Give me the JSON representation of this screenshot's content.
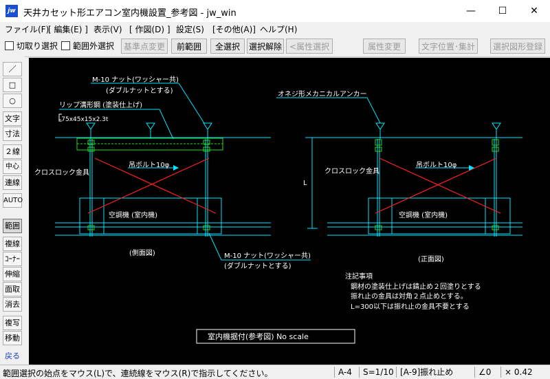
{
  "window": {
    "title": "天井カセット形エアコン室内機設置_参考図 - jw_win",
    "icon_label": "jw",
    "minimize": "—",
    "maximize": "☐",
    "close": "✕"
  },
  "menu": [
    "ファイル(F)",
    "[ 編集(E) ]",
    "表示(V)",
    "[ 作図(D) ]",
    "設定(S)",
    "[その他(A)]",
    "ヘルプ(H)"
  ],
  "toolbar": {
    "check_cut": "切取り選択",
    "check_outside": "範囲外選択",
    "btn_base_change": "基準点変更",
    "btn_prev_range": "前範囲",
    "btn_select_all": "全選択",
    "btn_deselect": "選択解除",
    "btn_attr_select": "<属性選択>",
    "btn_attr_change": "属性変更",
    "btn_text_pos": "文字位置･集計",
    "btn_register": "選択図形登録"
  },
  "left_tools": {
    "line": "／",
    "rect": "□",
    "circle": "○",
    "text": "文字",
    "dim": "寸法",
    "double_line": "２線",
    "center_line": "中心線",
    "continuous": "連線",
    "auto": "AUTO",
    "range": "範囲",
    "multi_line": "複線",
    "corner": "ｺｰﾅｰ",
    "stretch": "伸縮",
    "chamfer": "面取",
    "erase": "消去",
    "copy": "複写",
    "move": "移動",
    "back": "戻る"
  },
  "drawing": {
    "side_nut_label": "M-10 ナット(ワッシャー共)",
    "side_nut_sub": "(ダブルナットとする)",
    "channel_label": "リップ溝形鋼 (塗装仕上げ)",
    "channel_spec": "-75x45x15x2.3t",
    "cross_lock_side": "クロスロック金具",
    "hanger_bolt_side": "吊ボルト10φ",
    "unit_side": "空調機 (室内機)",
    "bottom_nut_label": "M-10 ナット(ワッシャー共)",
    "bottom_nut_sub": "(ダブルナットとする)",
    "side_view": "(側面図)",
    "anchor_label": "オネジ形メカニカルアンカー",
    "cross_lock_front": "クロスロック金具",
    "hanger_bolt_front": "吊ボルト10φ",
    "unit_front": "空調機 (室内機)",
    "dim_L": "L",
    "front_view": "(正面図)",
    "notes_title": "注記事項",
    "note1": "鋼材の塗装仕上げは錆止め２回塗りとする",
    "note2": "振れ止の金具は対角２点止めとする。",
    "note3": "L=300以下は振れ止の金具不要とする",
    "title_block": "室内機据付(参考図)  No scale"
  },
  "status": {
    "message": "範囲選択の始点をマウス(L)で、連続線をマウス(R)で指示してください。",
    "paper": "A-4",
    "scale": "S=1/10",
    "layer": "[A-9]振れ止め",
    "angle": "∠0",
    "zoom": "× 0.42"
  },
  "colors": {
    "cyan": "#00e5ff",
    "red": "#ff2020",
    "green": "#22dd22",
    "white": "#ffffff",
    "canvas_bg": "#000000"
  }
}
